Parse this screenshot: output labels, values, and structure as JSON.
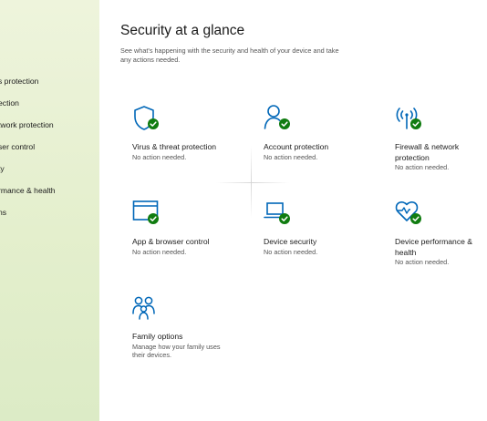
{
  "sidebar": {
    "items": [
      {
        "label": "s protection"
      },
      {
        "label": "ection"
      },
      {
        "label": "twork protection"
      },
      {
        "label": "ser control"
      },
      {
        "label": "ty"
      },
      {
        "label": "rmance & health"
      },
      {
        "label": "ns"
      }
    ]
  },
  "main": {
    "title": "Security at a glance",
    "subtitle": "See what's happening with the security and health of your device and take any actions needed."
  },
  "tiles": [
    {
      "name": "Virus & threat protection",
      "status": "No action needed.",
      "icon": "shield-icon"
    },
    {
      "name": "Account protection",
      "status": "No action needed.",
      "icon": "person-icon"
    },
    {
      "name": "Firewall & network protection",
      "status": "No action needed.",
      "icon": "antenna-icon"
    },
    {
      "name": "App & browser control",
      "status": "No action needed.",
      "icon": "browser-window-icon"
    },
    {
      "name": "Device security",
      "status": "No action needed.",
      "icon": "laptop-icon"
    },
    {
      "name": "Device performance & health",
      "status": "No action needed.",
      "icon": "heart-icon"
    },
    {
      "name": "Family options",
      "status": "Manage how your family uses their devices.",
      "icon": "family-icon"
    }
  ],
  "colors": {
    "accent": "#0067b8",
    "check": "#107c10",
    "sidebar": "#e4efcd"
  }
}
